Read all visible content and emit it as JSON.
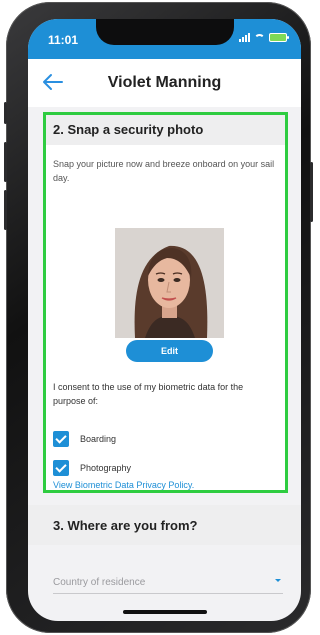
{
  "status_bar": {
    "time": "11:01"
  },
  "nav": {
    "title": "Violet Manning"
  },
  "section2": {
    "heading": "2. Snap a security photo",
    "intro": "Snap your picture now and breeze onboard on your sail day.",
    "edit_label": "Edit",
    "consent_text": "I consent to the use of my biometric data for the purpose of:",
    "options": [
      {
        "label": "Boarding",
        "checked": true
      },
      {
        "label": "Photography",
        "checked": true
      }
    ],
    "privacy_link": "View Biometric Data Privacy Policy."
  },
  "section3": {
    "heading": "3. Where are you from?",
    "country_placeholder": "Country of residence"
  },
  "colors": {
    "accent": "#1e8fd6",
    "highlight": "#2ecc40",
    "battery": "#7ed957"
  },
  "icons": {
    "back": "arrow-left",
    "checkbox": "check",
    "dropdown": "caret-down"
  }
}
